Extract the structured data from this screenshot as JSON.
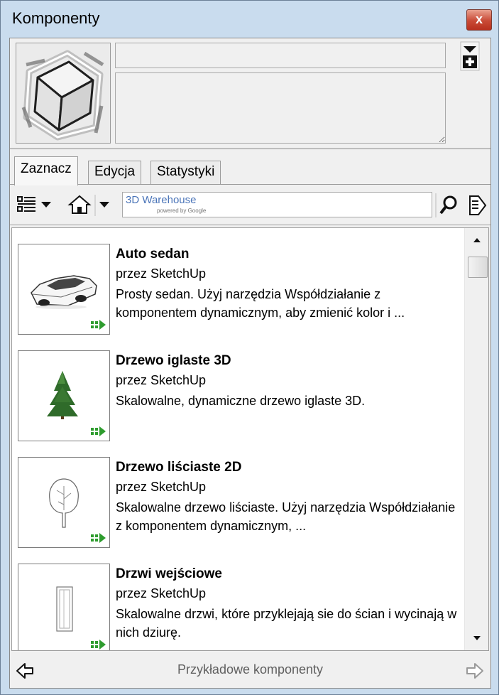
{
  "window": {
    "title": "Komponenty",
    "close_label": "x"
  },
  "info": {
    "name_value": "",
    "description_value": ""
  },
  "tabs": [
    {
      "label": "Zaznacz",
      "active": true
    },
    {
      "label": "Edycja",
      "active": false
    },
    {
      "label": "Statystyki",
      "active": false
    }
  ],
  "toolbar": {
    "view_options_icon": "list-view-icon",
    "home_icon": "home-icon",
    "search": {
      "value": "",
      "logo_text": "3D Warehouse",
      "logo_subtext": "powered by Google"
    },
    "search_icon": "magnifier-icon",
    "details_icon": "details-arrow-icon"
  },
  "items": [
    {
      "title": "Auto sedan",
      "author": "przez SketchUp",
      "description": "Prosty sedan. Użyj narzędzia Współdziałanie z komponentem dynamicznym, aby zmienić kolor i ...",
      "thumbnail_icon": "car-thumbnail",
      "dynamic_icon": "dynamic-component-icon"
    },
    {
      "title": "Drzewo iglaste 3D",
      "author": "przez SketchUp",
      "description": "Skalowalne, dynamiczne drzewo iglaste 3D.",
      "thumbnail_icon": "conifer-tree-thumbnail",
      "dynamic_icon": "dynamic-component-icon"
    },
    {
      "title": "Drzewo liściaste 2D",
      "author": "przez SketchUp",
      "description": "Skalowalne drzewo liściaste. Użyj narzędzia Współdziałanie z komponentem dynamicznym, ...",
      "thumbnail_icon": "deciduous-tree-thumbnail",
      "dynamic_icon": "dynamic-component-icon"
    },
    {
      "title": "Drzwi wejściowe",
      "author": "przez SketchUp",
      "description": "Skalowalne drzwi, które przyklejają sie do ścian i wycinają w nich dziurę.",
      "thumbnail_icon": "door-thumbnail",
      "dynamic_icon": "dynamic-component-icon"
    }
  ],
  "footer": {
    "collection_label": "Przykładowe komponenty",
    "back_icon": "back-arrow-icon",
    "forward_icon": "forward-arrow-icon"
  },
  "colors": {
    "window_frame": "#c9dcee",
    "close_button": "#c94a36",
    "dynamic_badge": "#2e9c2e",
    "warehouse_logo": "#4a74b8"
  }
}
